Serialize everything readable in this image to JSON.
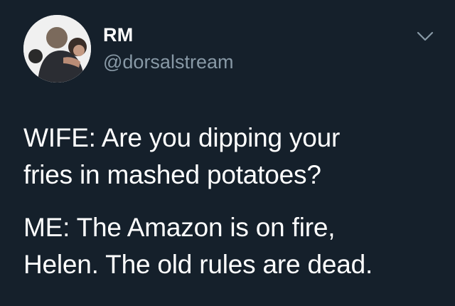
{
  "tweet": {
    "author": {
      "display_name": "RM",
      "handle": "@dorsalstream",
      "avatar_icon": "profile-photo"
    },
    "menu_icon": "chevron-down-icon",
    "paragraphs": [
      "WIFE: Are you dipping your\nfries in mashed potatoes?",
      "ME: The Amazon is on fire,\nHelen. The old rules are dead."
    ]
  },
  "colors": {
    "background": "#15202b",
    "text": "#ffffff",
    "secondary": "#8899a6"
  }
}
